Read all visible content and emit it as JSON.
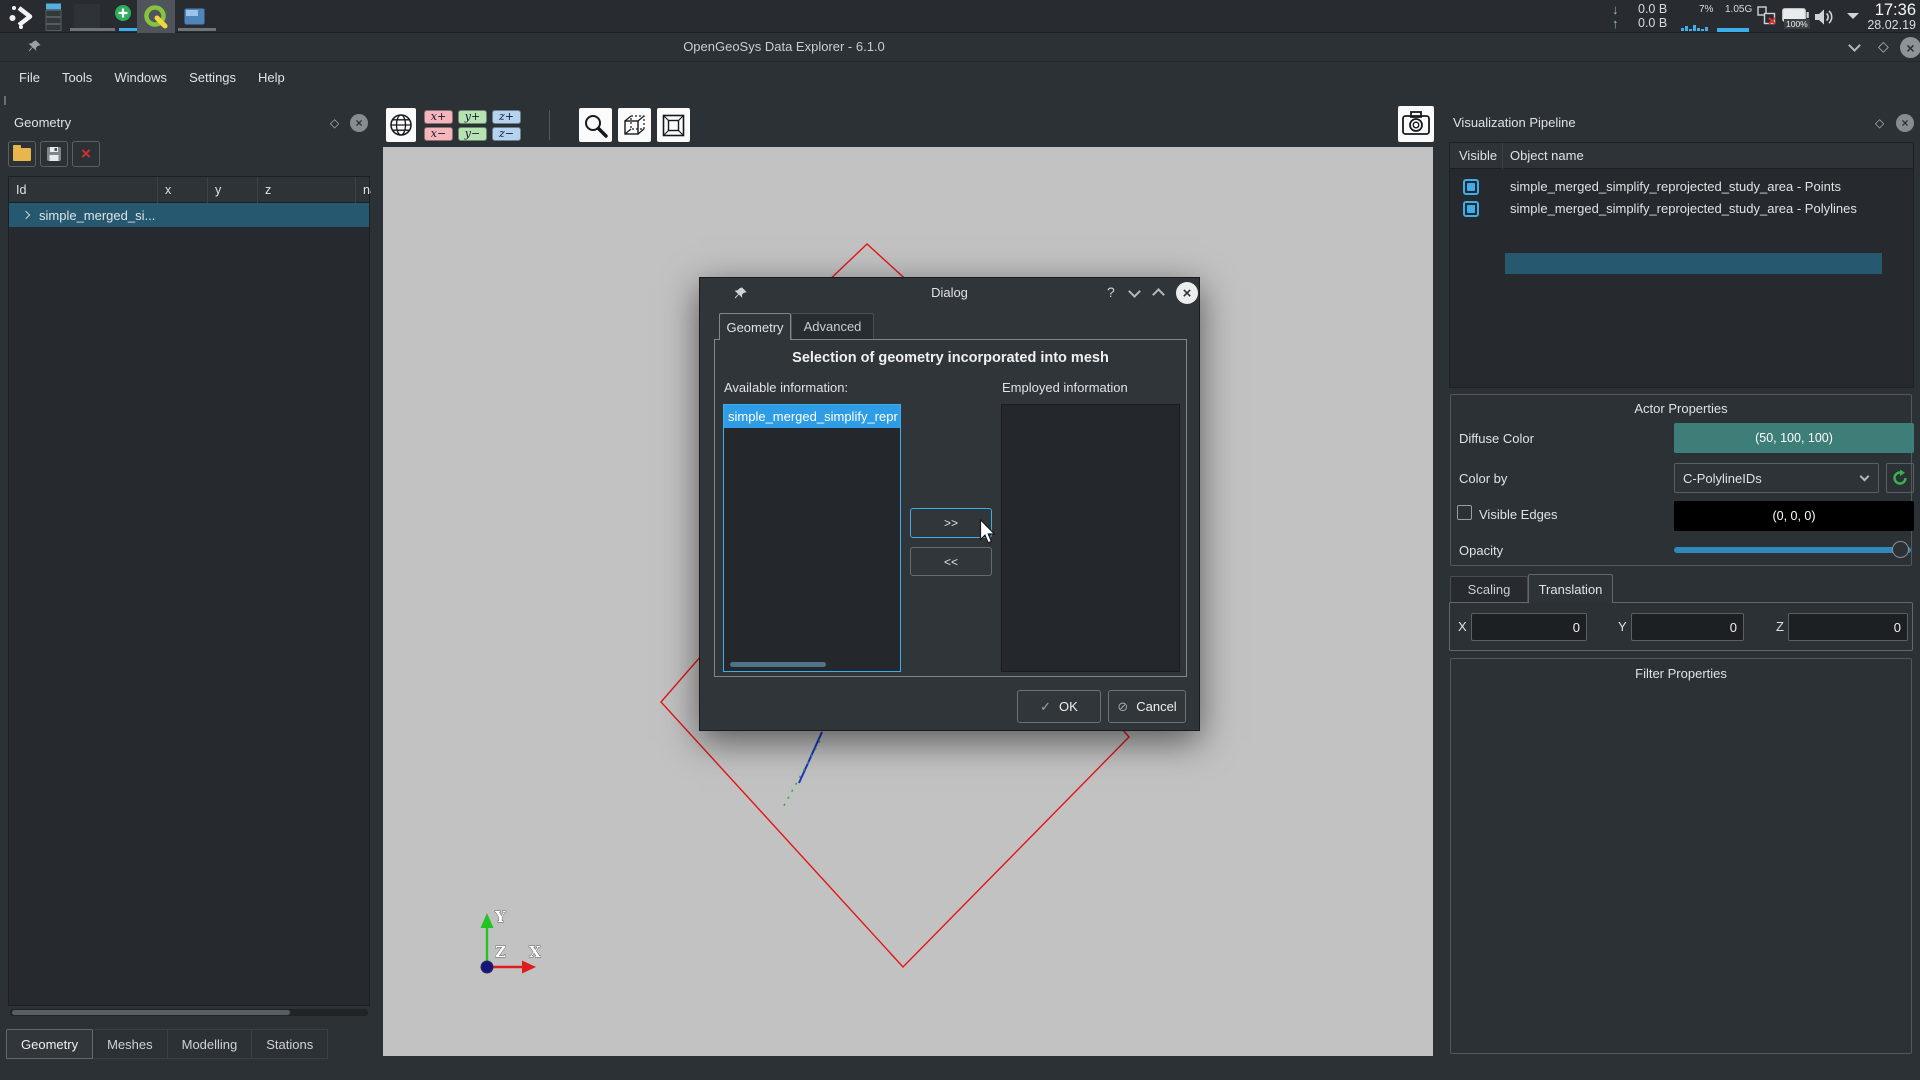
{
  "taskbar": {
    "net_down_label": "0.0 B",
    "net_up_label": "0.0 B",
    "cpu_percent": "7%",
    "mem_usage": "1.05G",
    "battery_percent": "100%",
    "clock_time": "17:36",
    "clock_date": "28.02.19"
  },
  "titlebar": {
    "title": "OpenGeoSys Data Explorer - 6.1.0"
  },
  "menubar": {
    "items": [
      {
        "label": "File"
      },
      {
        "label": "Tools"
      },
      {
        "label": "Windows"
      },
      {
        "label": "Settings"
      },
      {
        "label": "Help"
      }
    ]
  },
  "left_dock": {
    "title": "Geometry",
    "columns": [
      {
        "label": "Id"
      },
      {
        "label": "x"
      },
      {
        "label": "y"
      },
      {
        "label": "z"
      },
      {
        "label": "name"
      }
    ],
    "rows": [
      {
        "id": "simple_merged_si..."
      }
    ],
    "bottom_tabs": [
      {
        "label": "Geometry",
        "active": true
      },
      {
        "label": "Meshes"
      },
      {
        "label": "Modelling"
      },
      {
        "label": "Stations"
      }
    ]
  },
  "viewport_toolbar": {
    "x_plus": "x+",
    "y_plus": "y+",
    "z_plus": "z+",
    "x_minus": "x−",
    "y_minus": "y−",
    "z_minus": "z−"
  },
  "viewport": {
    "background": "#c2c2c2",
    "polyline_color": "#e31616",
    "selected_line_color": "#2230cc",
    "highlight_line_color": "#27b427",
    "axis_x_label": "X",
    "axis_y_label": "Y",
    "axis_z_label": "Z"
  },
  "dialog": {
    "title": "Dialog",
    "help_label": "?",
    "tabs": [
      {
        "label": "Geometry",
        "active": true
      },
      {
        "label": "Advanced"
      }
    ],
    "heading": "Selection of geometry incorporated into mesh",
    "available_label": "Available information:",
    "employed_label": "Employed information",
    "available_items": [
      {
        "label": "simple_merged_simplify_repr",
        "selected": true
      }
    ],
    "move_right_label": ">>",
    "move_left_label": "<<",
    "ok_label": "OK",
    "cancel_label": "Cancel"
  },
  "right_dock": {
    "title": "Visualization Pipeline",
    "tree_columns": [
      {
        "label": "Visible"
      },
      {
        "label": "Object name"
      }
    ],
    "tree_rows": [
      {
        "name": "simple_merged_simplify_reprojected_study_area - Points",
        "visible": true
      },
      {
        "name": "simple_merged_simplify_reprojected_study_area - Polylines",
        "visible": true,
        "selected": true
      }
    ],
    "actor": {
      "title": "Actor Properties",
      "diffuse_label": "Diffuse Color",
      "diffuse_value": "(50, 100, 100)",
      "diffuse_hex": "#3e7e79",
      "colorby_label": "Color by",
      "colorby_value": "C-PolylineIDs",
      "edges_label": "Visible Edges",
      "edges_value": "(0, 0, 0)",
      "edges_hex": "#000000",
      "opacity_label": "Opacity"
    },
    "transform_tabs": [
      {
        "label": "Scaling"
      },
      {
        "label": "Translation",
        "active": true
      }
    ],
    "translation": {
      "x_label": "X",
      "x_value": "0",
      "y_label": "Y",
      "y_value": "0",
      "z_label": "Z",
      "z_value": "0"
    },
    "filter": {
      "title": "Filter Properties"
    }
  },
  "colors": {
    "accent": "#3daee9",
    "selection": "#26596f"
  }
}
